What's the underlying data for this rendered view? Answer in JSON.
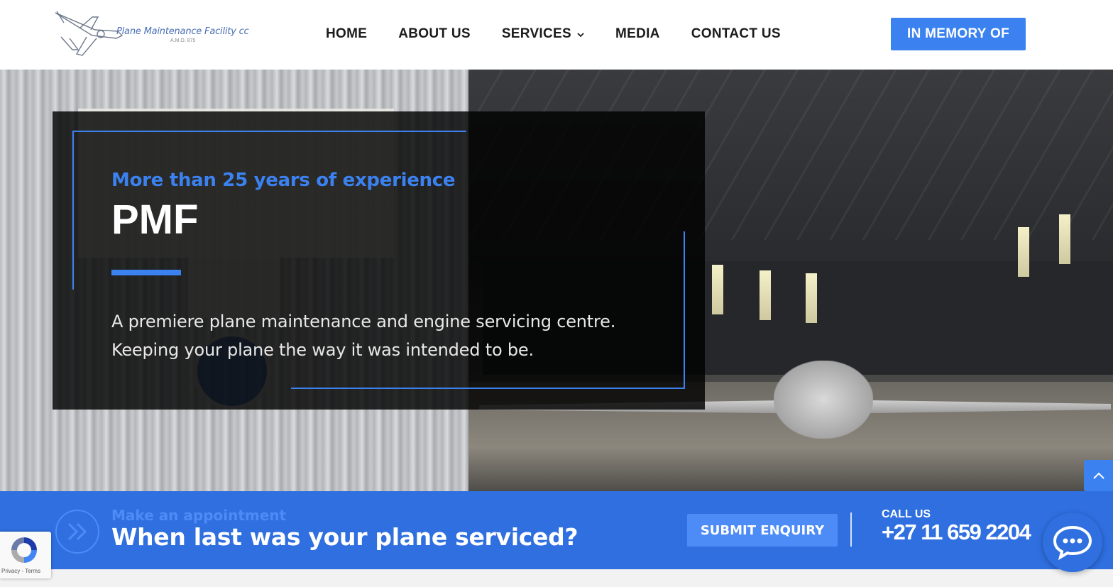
{
  "brand": {
    "name": "Plane Maintenance Facility cc",
    "sub": "A.M.O. 875"
  },
  "nav": {
    "items": [
      "HOME",
      "ABOUT US",
      "SERVICES",
      "MEDIA",
      "CONTACT US"
    ],
    "memory_label": "IN MEMORY OF"
  },
  "hero": {
    "eyebrow": "More than 25 years of experience",
    "title": "PMF",
    "description_line1": "A premiere plane maintenance and engine servicing centre.",
    "description_line2": "Keeping your plane the way it was intended to be."
  },
  "cta": {
    "eyebrow": "Make an appointment",
    "title": "When last was your plane serviced?",
    "button_label": "SUBMIT ENQUIRY",
    "call_label": "CALL US",
    "call_number": "+27 11 659 2204"
  },
  "recaptcha": {
    "links": "Privacy - Terms"
  },
  "colors": {
    "accent": "#3b82f0",
    "cta_bar": "#2f6fe0"
  }
}
